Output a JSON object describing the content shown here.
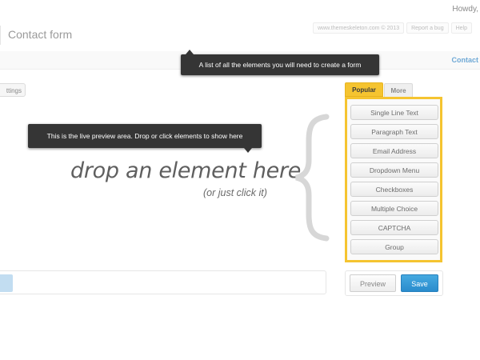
{
  "admin_bar": {
    "greeting": "Howdy,"
  },
  "header": {
    "title": "Contact form",
    "links": [
      "www.themeskeleton.com © 2013",
      "Report a bug",
      "Help"
    ]
  },
  "subbar": {
    "contact_link": "Contact"
  },
  "settings_tab": {
    "label": "ttings"
  },
  "tooltips": {
    "elements": "A list of all the elements you will need to create a form",
    "preview": "This is the live preview area. Drop or click elements to show here"
  },
  "drop_area": {
    "headline": "drop an element here",
    "subline": "(or just click it)"
  },
  "tabs": {
    "popular": "Popular",
    "more": "More"
  },
  "elements": [
    "Single Line Text",
    "Paragraph Text",
    "Email Address",
    "Dropdown Menu",
    "Checkboxes",
    "Multiple Choice",
    "CAPTCHA",
    "Group"
  ],
  "actions": {
    "preview": "Preview",
    "save": "Save"
  },
  "colors": {
    "accent_yellow": "#f5c430",
    "save_blue": "#2a8ccd",
    "tooltip_bg": "#353535"
  }
}
